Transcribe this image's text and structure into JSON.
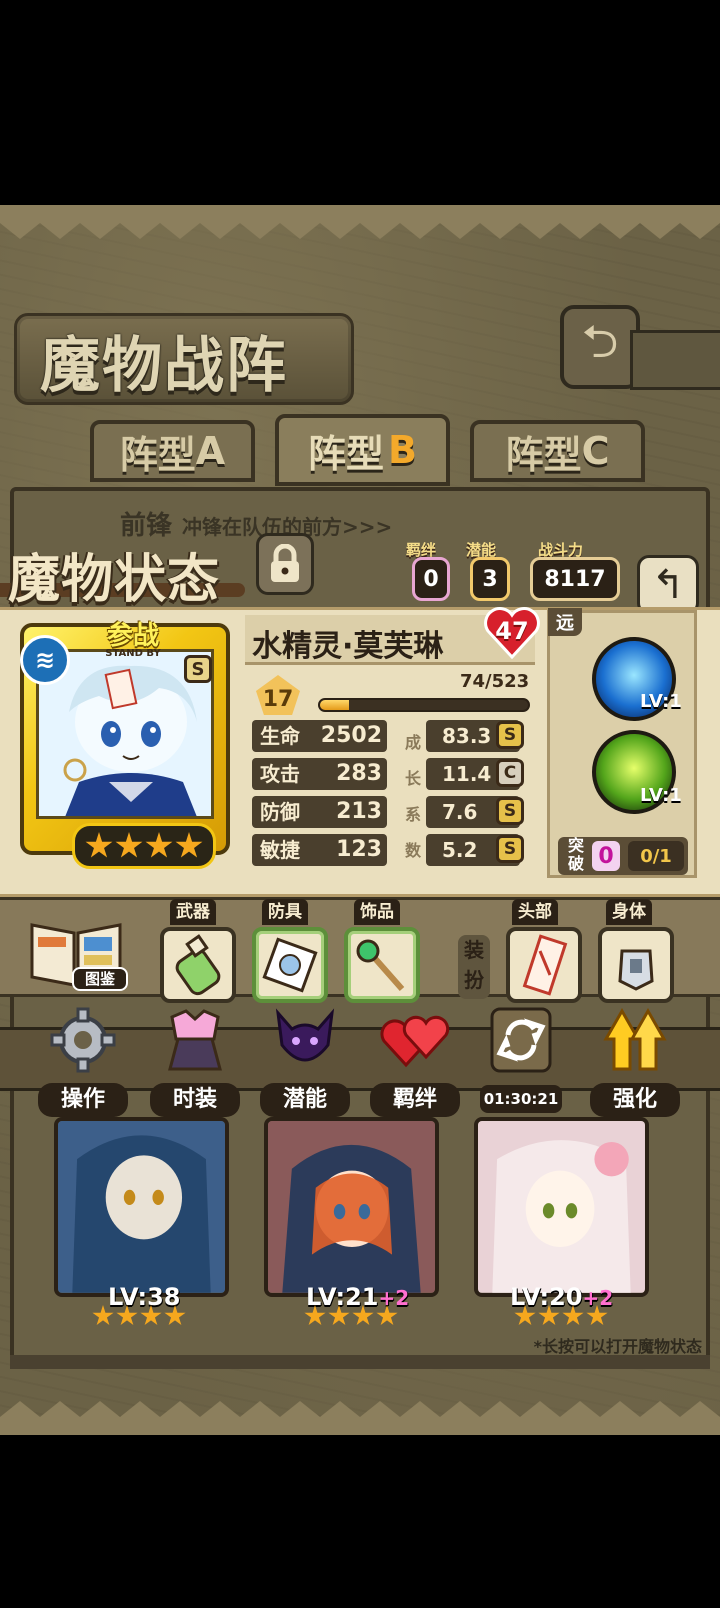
{
  "screen_title": "魔物战阵",
  "formation_tabs": [
    {
      "label": "阵型",
      "suffix": "A"
    },
    {
      "label": "阵型",
      "suffix": "B",
      "selected": true
    },
    {
      "label": "阵型",
      "suffix": "C"
    }
  ],
  "vanguard": {
    "title": "前锋",
    "desc": "冲锋在队伍的前方>>>"
  },
  "status_title": "魔物状态",
  "header_stats": {
    "bond_label": "羁绊",
    "bond_value": "0",
    "potential_label": "潜能",
    "potential_value": "3",
    "power_label": "战斗力",
    "power_value": "8117"
  },
  "hero": {
    "name": "水精灵·莫芙琳",
    "heart_value": "47",
    "standby_label": "参战",
    "standby_sub": "STAND BY",
    "element": "water-icon",
    "rank": "S",
    "stars": 4,
    "level": "17",
    "exp_text": "74/523",
    "exp_ratio": 0.1415,
    "range_tag": "远"
  },
  "stats": [
    {
      "name": "生命",
      "value": "2502",
      "growth": "83.3",
      "grade": "S"
    },
    {
      "name": "攻击",
      "value": "283",
      "growth": "11.4",
      "grade": "C"
    },
    {
      "name": "防御",
      "value": "213",
      "growth": "7.6",
      "grade": "S"
    },
    {
      "name": "敏捷",
      "value": "123",
      "growth": "5.2",
      "grade": "S"
    }
  ],
  "growth_label": [
    "成",
    "长",
    "系",
    "数"
  ],
  "skills": [
    {
      "icon": "water-pillar-skill-icon",
      "level": "LV:1"
    },
    {
      "icon": "wind-spirit-skill-icon",
      "level": "LV:1"
    }
  ],
  "breakthrough": {
    "label_top": "突",
    "label_bottom": "破",
    "count": "0",
    "progress": "0/1"
  },
  "equipment": {
    "codex_label": "图鉴",
    "slots": [
      {
        "tag": "武器",
        "icon": "potion-bottle-icon"
      },
      {
        "tag": "防具",
        "icon": "scroll-icon"
      },
      {
        "tag": "饰品",
        "icon": "magic-wand-icon"
      }
    ],
    "dress_label_top": "装",
    "dress_label_bottom": "扮",
    "appearance_slots": [
      {
        "tag": "头部",
        "icon": "talisman-icon"
      },
      {
        "tag": "身体",
        "icon": "armor-icon"
      }
    ]
  },
  "actions": [
    {
      "label": "操作",
      "icon": "gear-icon"
    },
    {
      "label": "时装",
      "icon": "outfit-icon"
    },
    {
      "label": "潜能",
      "icon": "demon-icon"
    },
    {
      "label": "羁绊",
      "icon": "hearts-icon"
    },
    {
      "label": "",
      "icon": "swap-icon",
      "timer": "01:30:21"
    },
    {
      "label": "强化",
      "icon": "upgrade-arrows-icon"
    }
  ],
  "roster": [
    {
      "level": "LV:38",
      "plus": "",
      "stars": 4
    },
    {
      "level": "LV:21",
      "plus": "+2",
      "stars": 4
    },
    {
      "level": "LV:20",
      "plus": "+2",
      "stars": 4
    }
  ],
  "hint": "*长按可以打开魔物状态",
  "colors": {
    "panel": "#eadfbe",
    "accent_gold": "#f2c614",
    "heart": "#d7202c",
    "bond_pink": "#e8a6d2"
  }
}
